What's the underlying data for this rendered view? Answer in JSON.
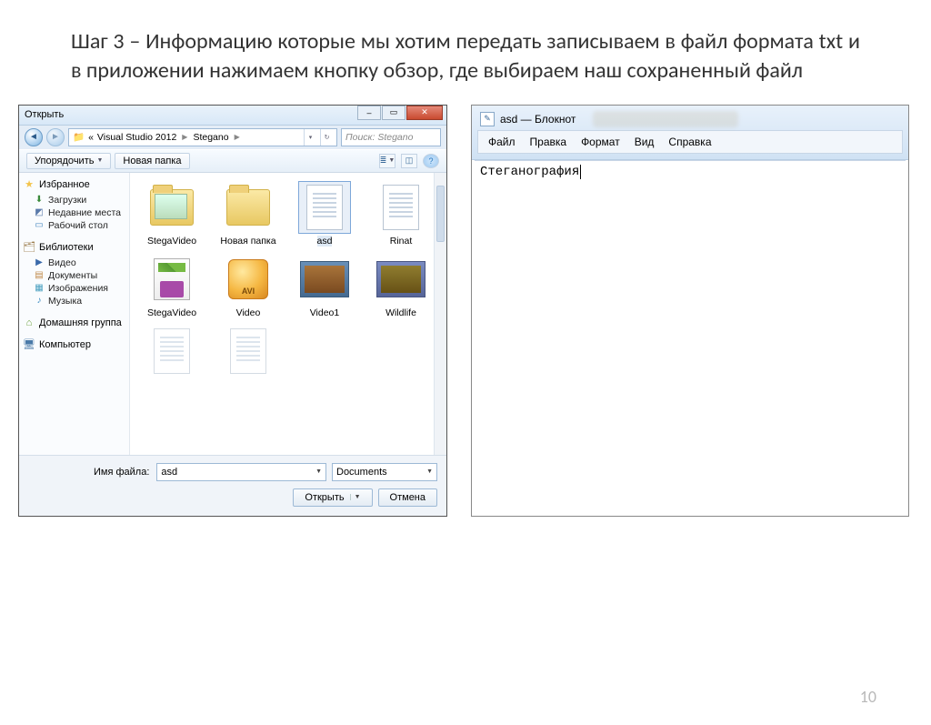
{
  "slide": {
    "text": "Шаг 3 – Информацию которые мы хотим передать записываем в файл формата txt и в приложении нажимаем кнопку обзор, где выбираем наш сохраненный файл",
    "page_number": "10"
  },
  "dialog": {
    "title": "Открыть",
    "path_prefix": "«",
    "path_seg1": "Visual Studio 2012",
    "path_seg2": "Stegano",
    "search_placeholder": "Поиск: Stegano",
    "toolbar": {
      "organize": "Упорядочить",
      "new_folder": "Новая папка"
    },
    "sidebar": {
      "favorites": "Избранное",
      "downloads": "Загрузки",
      "recent": "Недавние места",
      "desktop": "Рабочий стол",
      "libraries": "Библиотеки",
      "videos": "Видео",
      "documents": "Документы",
      "images": "Изображения",
      "music": "Музыка",
      "homegroup": "Домашняя группа",
      "computer": "Компьютер"
    },
    "items": {
      "i0": "StegaVideo",
      "i1": "Новая папка",
      "i2": "asd",
      "i3": "Rinat",
      "i4": "StegaVideo",
      "i5": "Video",
      "i6": "Video1",
      "i7": "Wildlife"
    },
    "filename_label": "Имя файла:",
    "filename_value": "asd",
    "filter_value": "Documents",
    "open_btn": "Открыть",
    "cancel_btn": "Отмена"
  },
  "notepad": {
    "title": "asd — Блокнот",
    "menu": {
      "file": "Файл",
      "edit": "Правка",
      "format": "Формат",
      "view": "Вид",
      "help": "Справка"
    },
    "content": "Стеганография"
  }
}
